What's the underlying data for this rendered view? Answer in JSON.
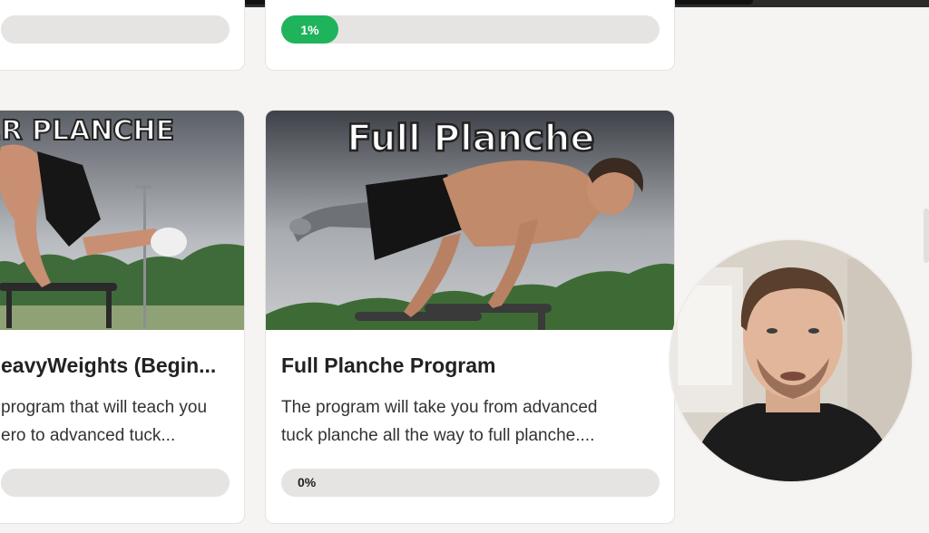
{
  "top_cards": [
    {
      "progress_label": "",
      "progress_value": 0
    },
    {
      "progress_label": "1%",
      "progress_value": 0.01
    }
  ],
  "cards": [
    {
      "thumbnail_title": "ER PLANCHE",
      "title": "eavyWeights (Begin...",
      "description_line1": "program that will teach you",
      "description_line2": "ero to advanced tuck...",
      "progress_label": "",
      "progress_value": 0
    },
    {
      "thumbnail_title": "Full Planche",
      "title": "Full Planche Program",
      "description_line1": "The program will take you from advanced",
      "description_line2": "tuck planche all the way to full planche....",
      "progress_label": "0%",
      "progress_value": 0
    }
  ],
  "video_bubble": {
    "icon": "presenter-webcam-feed"
  },
  "colors": {
    "progress_green": "#1fb35c",
    "progress_track": "#e5e4e3",
    "page_bg": "#f5f4f2"
  }
}
